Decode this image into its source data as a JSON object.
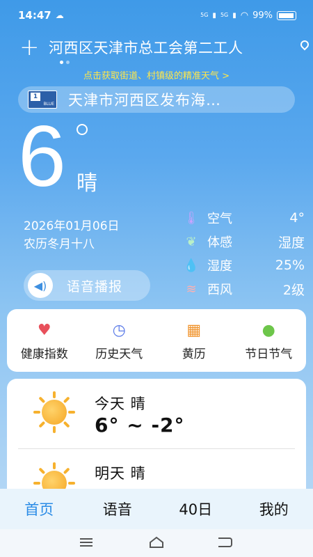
{
  "status_bar": {
    "time": "14:47",
    "network_1": "5G",
    "network_2": "5G",
    "battery_text": "99%"
  },
  "location": {
    "name": "河西区天津市总工会第二工人",
    "street_link": "点击获取街道、村镇级的精准天气 >"
  },
  "alert": {
    "text": "天津市河西区发布海…",
    "badge_text": "BLUE",
    "badge_num": "1"
  },
  "current": {
    "temperature": "6",
    "condition": "晴",
    "date": "2026年01月06日",
    "lunar": "农历冬月十八",
    "voice_label": "语音播报"
  },
  "details": [
    {
      "icon": "thermometer-icon",
      "label": "空气",
      "value": "4°"
    },
    {
      "icon": "leaf-icon",
      "label": "体感",
      "value": "湿度"
    },
    {
      "icon": "drop-icon",
      "label": "湿度",
      "value": "25%"
    },
    {
      "icon": "wind-icon",
      "label": "西风",
      "value": "2级"
    }
  ],
  "quick_menu": [
    {
      "icon": "heart-pulse-icon",
      "label": "健康指数"
    },
    {
      "icon": "clock-icon",
      "label": "历史天气"
    },
    {
      "icon": "calendar-icon",
      "label": "黄历"
    },
    {
      "icon": "balloon-icon",
      "label": "节日节气"
    }
  ],
  "forecast": [
    {
      "icon": "sun-icon",
      "title": "今天  晴",
      "range": "6° ~ -2°"
    },
    {
      "icon": "sun-icon",
      "title": "明天  晴",
      "range": ""
    }
  ],
  "tabs": [
    {
      "label": "首页",
      "active": true
    },
    {
      "label": "语音",
      "active": false
    },
    {
      "label": "40日",
      "active": false
    },
    {
      "label": "我的",
      "active": false
    }
  ],
  "colors": {
    "accent": "#2a8be6",
    "link_yellow": "#ffe74a",
    "bg_top": "#3f9ae8"
  }
}
